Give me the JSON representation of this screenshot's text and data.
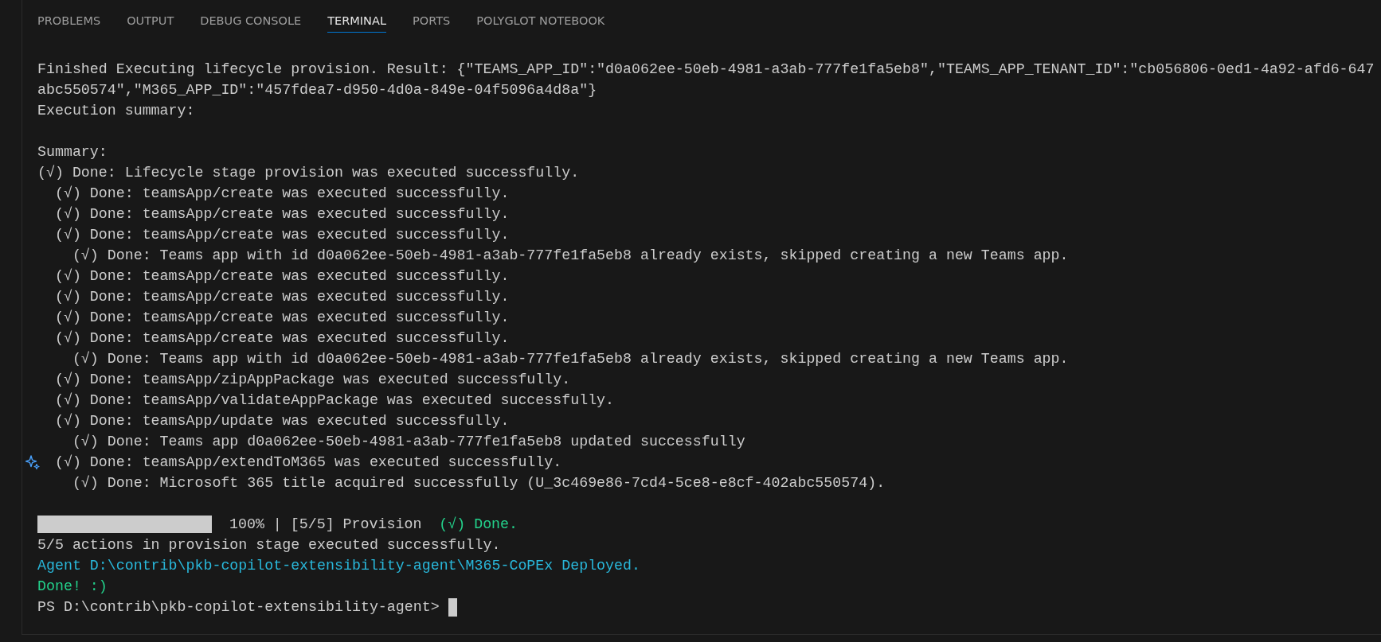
{
  "tabs": [
    {
      "label": "PROBLEMS",
      "selected": false
    },
    {
      "label": "OUTPUT",
      "selected": false
    },
    {
      "label": "DEBUG CONSOLE",
      "selected": false
    },
    {
      "label": "TERMINAL",
      "selected": true
    },
    {
      "label": "PORTS",
      "selected": false
    },
    {
      "label": "POLYGLOT NOTEBOOK",
      "selected": false
    }
  ],
  "terminal": {
    "result_lines": [
      "Finished Executing lifecycle provision. Result: {\"TEAMS_APP_ID\":\"d0a062ee-50eb-4981-a3ab-777fe1fa5eb8\",\"TEAMS_APP_TENANT_ID\":\"cb056806-0ed1-4a92-afd6-647",
      "abc550574\",\"M365_APP_ID\":\"457fdea7-d950-4d0a-849e-04f5096a4d8a\"}",
      "Execution summary:"
    ],
    "summary_title": "Summary:",
    "summary": {
      "text": "(√) Done: Lifecycle stage provision was executed successfully.",
      "gutter_icon": false,
      "children": [
        {
          "text": "(√) Done: teamsApp/create was executed successfully.",
          "gutter_icon": false
        },
        {
          "text": "(√) Done: teamsApp/create was executed successfully.",
          "gutter_icon": false
        },
        {
          "text": "(√) Done: teamsApp/create was executed successfully.",
          "gutter_icon": false,
          "children": [
            {
              "text": "(√) Done: Teams app with id d0a062ee-50eb-4981-a3ab-777fe1fa5eb8 already exists, skipped creating a new Teams app.",
              "gutter_icon": false
            }
          ]
        },
        {
          "text": "(√) Done: teamsApp/create was executed successfully.",
          "gutter_icon": false
        },
        {
          "text": "(√) Done: teamsApp/create was executed successfully.",
          "gutter_icon": false
        },
        {
          "text": "(√) Done: teamsApp/create was executed successfully.",
          "gutter_icon": false
        },
        {
          "text": "(√) Done: teamsApp/create was executed successfully.",
          "gutter_icon": false,
          "children": [
            {
              "text": "(√) Done: Teams app with id d0a062ee-50eb-4981-a3ab-777fe1fa5eb8 already exists, skipped creating a new Teams app.",
              "gutter_icon": false
            }
          ]
        },
        {
          "text": "(√) Done: teamsApp/zipAppPackage was executed successfully.",
          "gutter_icon": false
        },
        {
          "text": "(√) Done: teamsApp/validateAppPackage was executed successfully.",
          "gutter_icon": false
        },
        {
          "text": "(√) Done: teamsApp/update was executed successfully.",
          "gutter_icon": false,
          "children": [
            {
              "text": "(√) Done: Teams app d0a062ee-50eb-4981-a3ab-777fe1fa5eb8 updated successfully",
              "gutter_icon": false
            }
          ]
        },
        {
          "text": "(√) Done: teamsApp/extendToM365 was executed successfully.",
          "gutter_icon": true,
          "children": [
            {
              "text": "(√) Done: Microsoft 365 title acquired successfully (U_3c469e86-7cd4-5ce8-e8cf-402abc550574).",
              "gutter_icon": false
            }
          ]
        }
      ]
    },
    "progress": {
      "level": 1,
      "reading": "100% | [5/5] Provision",
      "status": "(√) Done."
    },
    "messages": [
      {
        "text": "5/5 actions in provision stage executed successfully.",
        "kind": "plain"
      },
      {
        "text": "Agent D:\\contrib\\pkb-copilot-extensibility-agent\\M365-CoPEx Deployed.",
        "kind": "info"
      },
      {
        "text": "Done! :)",
        "kind": "success"
      }
    ],
    "prompt": "PS D:\\contrib\\pkb-copilot-extensibility-agent>"
  }
}
